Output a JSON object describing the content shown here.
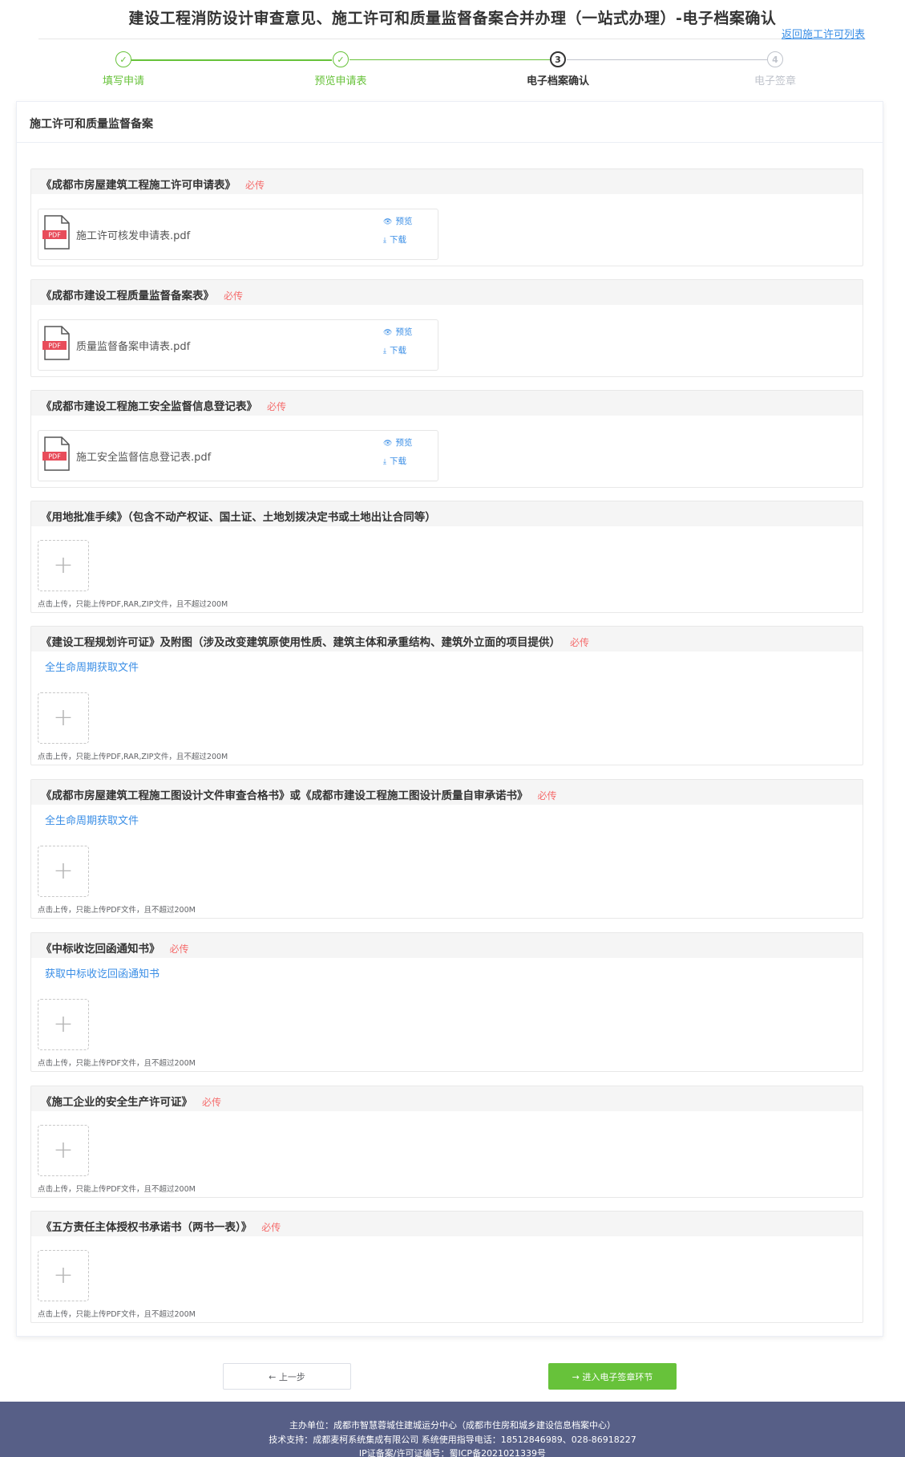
{
  "page": {
    "title": "建设工程消防设计审查意见、施工许可和质量监督备案合并办理（一站式办理）-电子档案确认",
    "back_link": "返回施工许可列表"
  },
  "steps": [
    {
      "label": "填写申请",
      "mark": "✓",
      "state": "done"
    },
    {
      "label": "预览申请表",
      "mark": "✓",
      "state": "done"
    },
    {
      "label": "电子档案确认",
      "mark": "3",
      "state": "active"
    },
    {
      "label": "电子签章",
      "mark": "4",
      "state": "todo"
    }
  ],
  "card": {
    "title": "施工许可和质量监督备案"
  },
  "labels": {
    "required": "必传",
    "preview": "预览",
    "download": "下载",
    "upload_hint_multi": "点击上传，只能上传PDF,RAR,ZIP文件，且不超过200M",
    "upload_hint_pdf": "点击上传，只能上传PDF文件，且不超过200M",
    "lifecycle_link": "全生命周期获取文件",
    "bid_link": "获取中标收讫回函通知书"
  },
  "sections": [
    {
      "title": "《成都市房屋建筑工程施工许可申请表》",
      "required": true,
      "file": "施工许可核发申请表.pdf"
    },
    {
      "title": "《成都市建设工程质量监督备案表》",
      "required": true,
      "file": "质量监督备案申请表.pdf"
    },
    {
      "title": "《成都市建设工程施工安全监督信息登记表》",
      "required": true,
      "file": "施工安全监督信息登记表.pdf"
    },
    {
      "title": "《用地批准手续》（包含不动产权证、国土证、土地划拨决定书或土地出让合同等）",
      "required": false
    },
    {
      "title": "《建设工程规划许可证》及附图（涉及改变建筑原使用性质、建筑主体和承重结构、建筑外立面的项目提供）",
      "required": true
    },
    {
      "title": "《成都市房屋建筑工程施工图设计文件审查合格书》或《成都市建设工程施工图设计质量自审承诺书》",
      "required": true
    },
    {
      "title": "《中标收讫回函通知书》",
      "required": true
    },
    {
      "title": "《施工企业的安全生产许可证》",
      "required": true
    },
    {
      "title": "《五方责任主体授权书承诺书（两书一表）》",
      "required": true
    }
  ],
  "buttons": {
    "prev": "← 上一步",
    "next": "→ 进入电子签章环节"
  },
  "footer": {
    "line1": "主办单位：成都市智慧蓉城住建城运分中心（成都市住房和城乡建设信息档案中心）",
    "line2": "技术支持：成都麦柯系统集成有限公司 系统使用指导电话：18512846989、028-86918227",
    "line3": "IP证备案/许可证编号：蜀ICP备2021021339号"
  },
  "colors": {
    "done": "#67c23a",
    "link": "#3a8ee6",
    "required": "#f56c6c",
    "footer_bg": "#575f87",
    "pdf_red": "#e84c5a"
  },
  "icons": {
    "step_done": "check-icon",
    "preview": "eye-icon",
    "download": "download-icon",
    "upload": "plus-icon",
    "file": "pdf-file-icon"
  }
}
